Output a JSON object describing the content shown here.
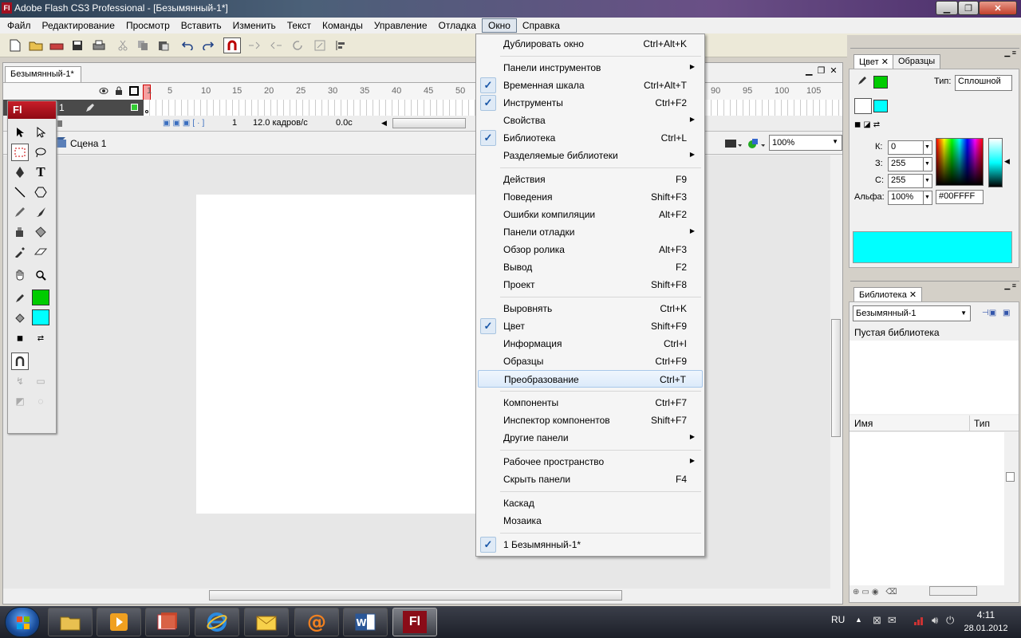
{
  "window": {
    "title": "Adobe Flash CS3 Professional - [Безымянный-1*]",
    "icon_letter": "Fl"
  },
  "menubar": [
    "Файл",
    "Редактирование",
    "Просмотр",
    "Вставить",
    "Изменить",
    "Текст",
    "Команды",
    "Управление",
    "Отладка",
    "Окно",
    "Справка"
  ],
  "document": {
    "tab": "Безымянный-1*",
    "layer": "1",
    "frame_numbers": [
      "1",
      "5",
      "10",
      "15",
      "20",
      "25",
      "30",
      "35",
      "40",
      "45",
      "50",
      "90",
      "95",
      "100",
      "105"
    ],
    "current_frame": "1",
    "fps": "12.0 кадров/с",
    "time": "0.0с",
    "scene": "Сцена 1",
    "zoom": "100%"
  },
  "tools": {
    "header": "Fl"
  },
  "color_panel": {
    "tabs": [
      "Цвет",
      "Образцы"
    ],
    "type_label": "Тип:",
    "type_value": "Сплошной",
    "r_label": "К:",
    "r_value": "0",
    "g_label": "З:",
    "g_value": "255",
    "b_label": "С:",
    "b_value": "255",
    "alpha_label": "Альфа:",
    "alpha_value": "100%",
    "hex": "#00FFFF",
    "stroke_color": "#00cc00",
    "fill_color": "#00ffff"
  },
  "library": {
    "tab": "Библиотека",
    "doc": "Безымянный-1",
    "empty": "Пустая библиотека",
    "col_name": "Имя",
    "col_type": "Тип"
  },
  "menu": {
    "items": [
      {
        "label": "Дублировать окно",
        "shortcut": "Ctrl+Alt+K"
      },
      {
        "label": "Панели инструментов",
        "submenu": true
      },
      {
        "label": "Временная шкала",
        "shortcut": "Ctrl+Alt+T",
        "checked": true
      },
      {
        "label": "Инструменты",
        "shortcut": "Ctrl+F2",
        "checked": true
      },
      {
        "label": "Свойства",
        "submenu": true
      },
      {
        "label": "Библиотека",
        "shortcut": "Ctrl+L",
        "checked": true
      },
      {
        "label": "Разделяемые библиотеки",
        "submenu": true
      },
      {
        "label": "Действия",
        "shortcut": "F9"
      },
      {
        "label": "Поведения",
        "shortcut": "Shift+F3"
      },
      {
        "label": "Ошибки компиляции",
        "shortcut": "Alt+F2"
      },
      {
        "label": "Панели отладки",
        "submenu": true
      },
      {
        "label": "Обзор ролика",
        "shortcut": "Alt+F3"
      },
      {
        "label": "Вывод",
        "shortcut": "F2"
      },
      {
        "label": "Проект",
        "shortcut": "Shift+F8"
      },
      {
        "label": "Выровнять",
        "shortcut": "Ctrl+K"
      },
      {
        "label": "Цвет",
        "shortcut": "Shift+F9",
        "checked": true
      },
      {
        "label": "Информация",
        "shortcut": "Ctrl+I"
      },
      {
        "label": "Образцы",
        "shortcut": "Ctrl+F9"
      },
      {
        "label": "Преобразование",
        "shortcut": "Ctrl+T",
        "highlighted": true
      },
      {
        "label": "Компоненты",
        "shortcut": "Ctrl+F7"
      },
      {
        "label": "Инспектор компонентов",
        "shortcut": "Shift+F7"
      },
      {
        "label": "Другие панели",
        "submenu": true
      },
      {
        "label": "Рабочее пространство",
        "submenu": true
      },
      {
        "label": "Скрыть панели",
        "shortcut": "F4"
      },
      {
        "label": "Каскад"
      },
      {
        "label": "Мозаика"
      },
      {
        "label": "1 Безымянный-1*",
        "checked": true
      }
    ]
  },
  "taskbar": {
    "lang": "RU",
    "time": "4:11",
    "date": "28.01.2012",
    "flash_label": "Fl"
  }
}
